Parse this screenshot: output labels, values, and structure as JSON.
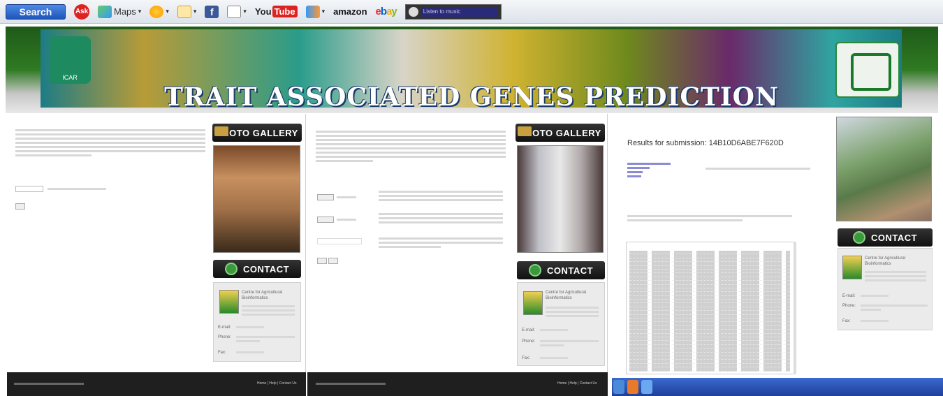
{
  "toolbar": {
    "search_label": "Search",
    "ask_label": "Ask",
    "maps_label": "Maps",
    "youtube_label": "You",
    "youtube_tube": "Tube",
    "amazon_label": "amazon",
    "ebay_label": "ebay",
    "music_label": "Listen to music"
  },
  "banner": {
    "title": "TRAIT ASSOCIATED GENES PREDICTION TOOL",
    "left_logo_text": "ICAR"
  },
  "sidebar": {
    "photo_gallery_label": "PHOTO GALLERY",
    "contact_label": "CONTACT",
    "contact_org": "Centre for Agricultural Bioinformatics",
    "email_label": "E-mail:",
    "phone_label": "Phone:",
    "fax_label": "Fax:"
  },
  "results": {
    "title": "Results for submission: 14B10D6ABE7F620D"
  },
  "footer": {
    "links": "Home | Help | Contact Us"
  },
  "colors": {
    "banner_green": "#2f7a22",
    "title_outline": "#1a3a6a",
    "footer_bg": "#1f1f1f",
    "taskbar_blue": "#1f3f9a"
  }
}
